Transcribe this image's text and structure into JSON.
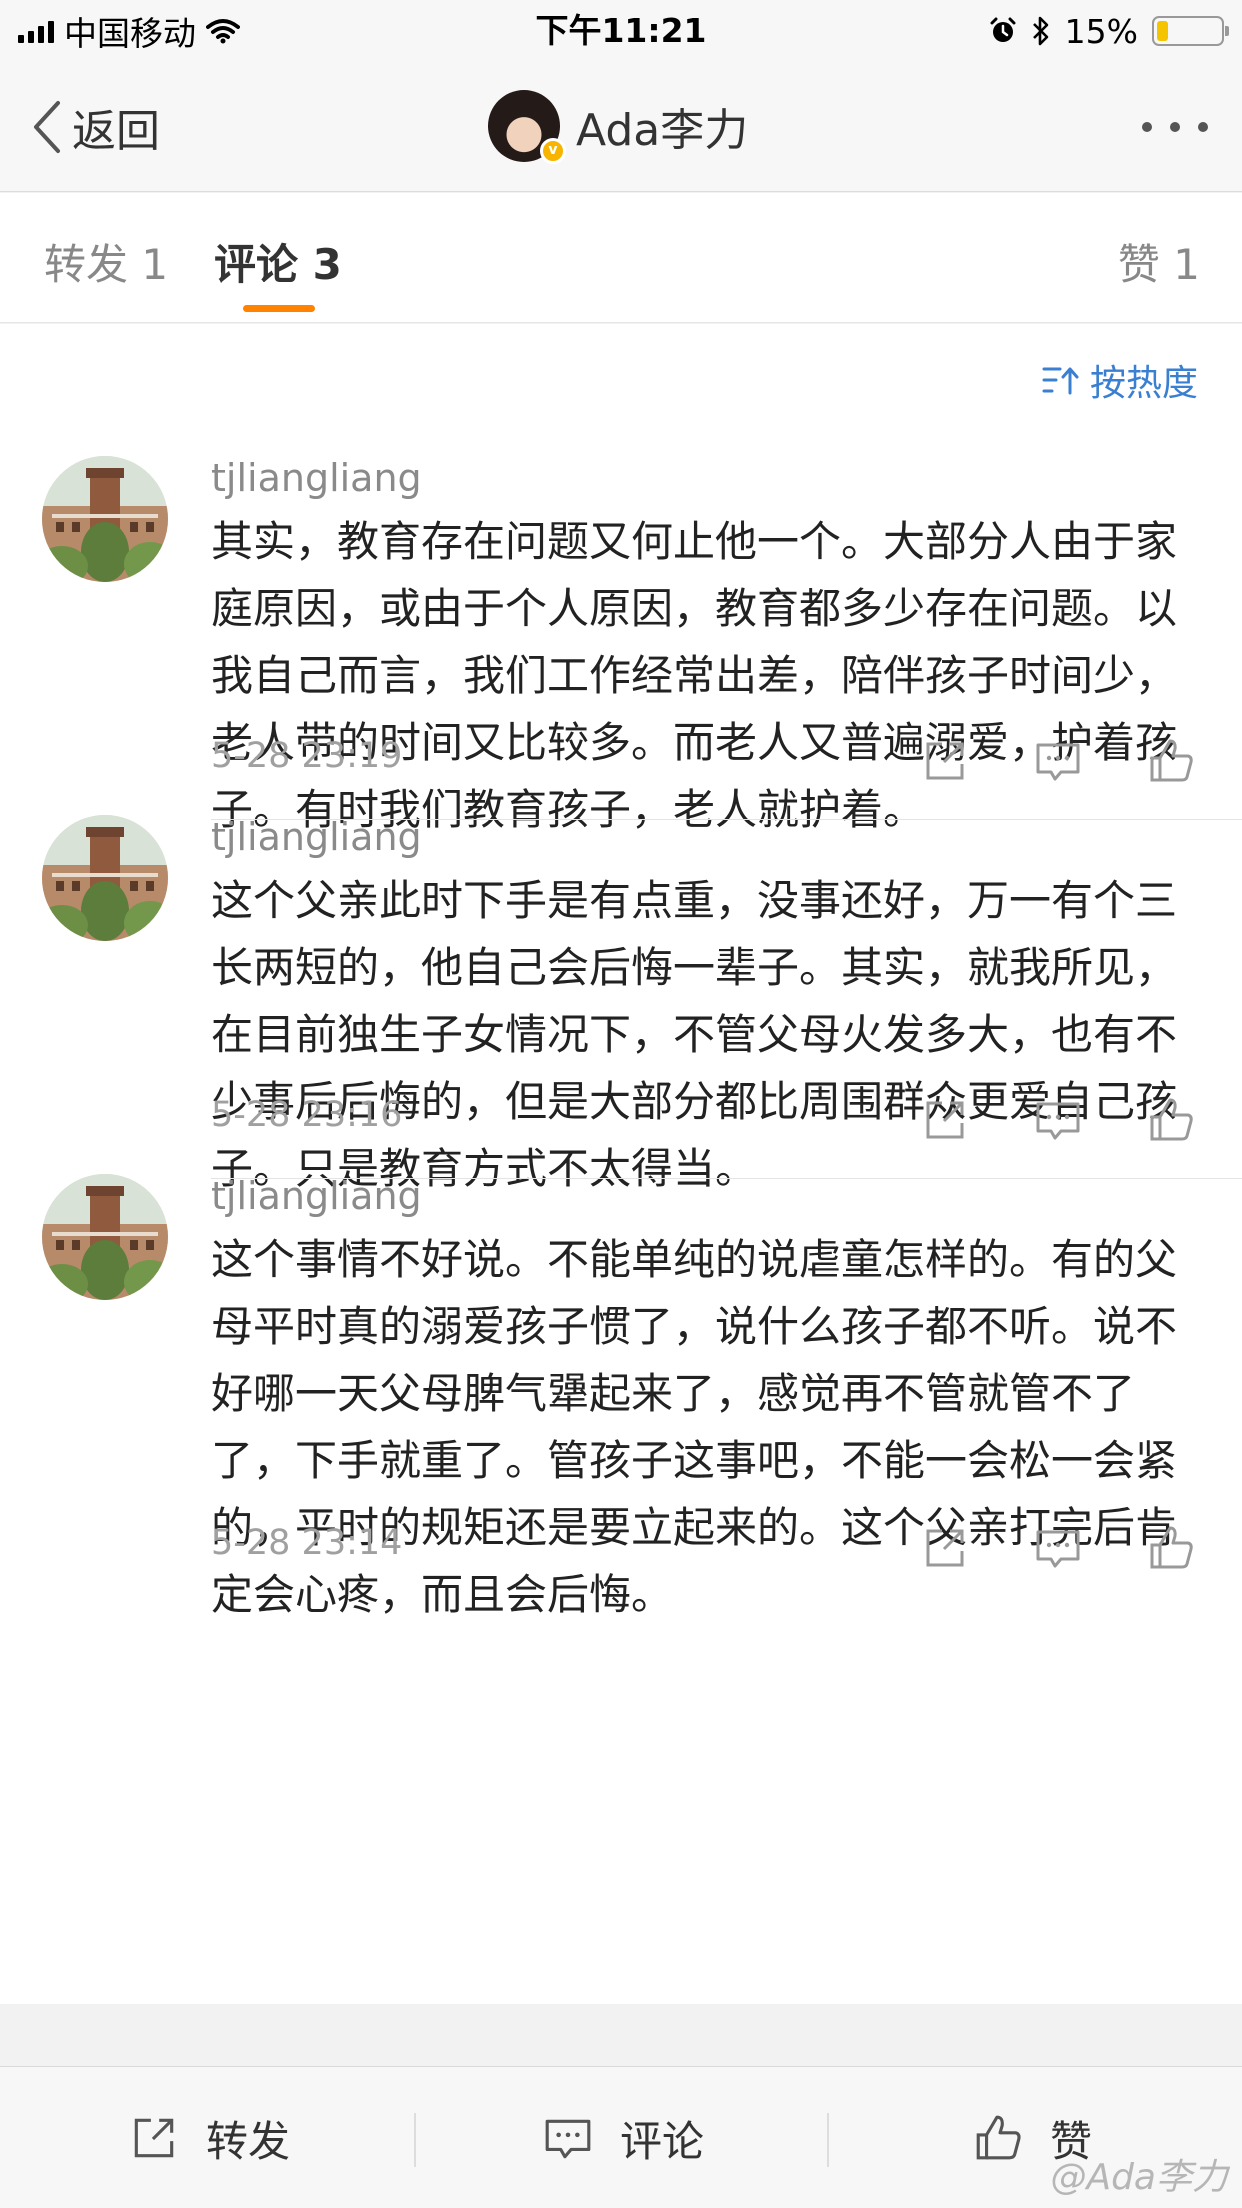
{
  "status_bar": {
    "carrier": "中国移动",
    "time": "下午11:21",
    "battery": "15%",
    "battery_level": 0.15
  },
  "nav": {
    "back_label": "返回",
    "title": "Ada李力"
  },
  "tabs": [
    {
      "label": "转发 1",
      "active": false
    },
    {
      "label": "评论 3",
      "active": true
    },
    {
      "label": "赞 1",
      "active": false
    }
  ],
  "sort_label": "按热度",
  "comments": [
    {
      "user": "tjliangliang",
      "text": "其实，教育存在问题又何止他一个。大部分人由于家庭原因，或由于个人原因，教育都多少存在问题。以我自己而言，我们工作经常出差，陪伴孩子时间少，老人带的时间又比较多。而老人又普遍溺爱，护着孩子。有时我们教育孩子，老人就护着。",
      "time": "5-28 23:19"
    },
    {
      "user": "tjliangliang",
      "text": "这个父亲此时下手是有点重，没事还好，万一有个三长两短的，他自己会后悔一辈子。其实，就我所见，在目前独生子女情况下，不管父母火发多大，也有不少事后后悔的，但是大部分都比周围群众更爱自己孩子。只是教育方式不太得当。",
      "time": "5-28 23:16"
    },
    {
      "user": "tjliangliang",
      "text": "这个事情不好说。不能单纯的说虐童怎样的。有的父母平时真的溺爱孩子惯了，说什么孩子都不听。说不好哪一天父母脾气犟起来了，感觉再不管就管不了了，下手就重了。管孩子这事吧，不能一会松一会紧的，平时的规矩还是要立起来的。这个父亲打完后肯定会心疼，而且会后悔。",
      "time": "5-28 23:14"
    }
  ],
  "comment_actions": [
    "share-icon",
    "comment-icon",
    "like-icon"
  ],
  "bottom_bar": {
    "repost": "转发",
    "comment": "评论",
    "like": "赞"
  },
  "watermark": "@Ada李力",
  "colors": {
    "accent": "#ff8200",
    "link": "#3a7fd0",
    "battery": "#f5c400"
  }
}
